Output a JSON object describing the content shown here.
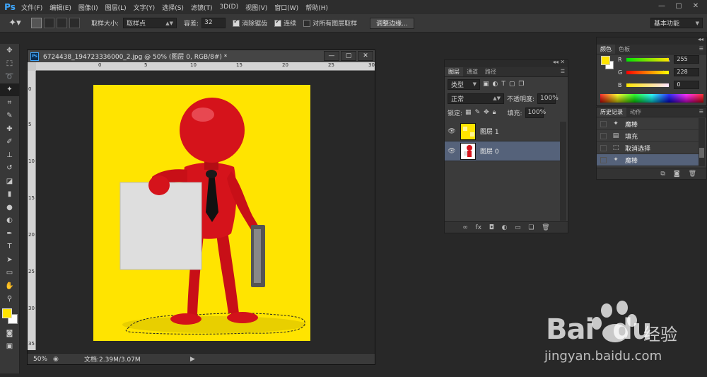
{
  "app": {
    "logo": "Ps",
    "menus": [
      "文件(F)",
      "编辑(E)",
      "图像(I)",
      "图层(L)",
      "文字(Y)",
      "选择(S)",
      "滤镜(T)",
      "3D(D)",
      "视图(V)",
      "窗口(W)",
      "帮助(H)"
    ],
    "window_controls": [
      "—",
      "▢",
      "✕"
    ]
  },
  "options": {
    "sample_size_label": "取样大小:",
    "sample_size_value": "取样点",
    "tolerance_label": "容差:",
    "tolerance_value": "32",
    "antialias_label": "消除锯齿",
    "contiguous_label": "连续",
    "all_layers_label": "对所有图层取样",
    "refine_edge_button": "调整边缘...",
    "workspace": "基本功能"
  },
  "document": {
    "title": "6724438_194723336000_2.jpg @ 50% (图层 0, RGB/8#) *",
    "ruler_h": [
      "0",
      "5",
      "10",
      "15",
      "20",
      "25",
      "30"
    ],
    "ruler_v": [
      "0",
      "5",
      "10",
      "15",
      "20",
      "25",
      "30",
      "35"
    ],
    "zoom": "50%",
    "doc_info": "文档:2.39M/3.07M",
    "colors": {
      "canvas": "#ffe400",
      "figure": "#d0101a"
    }
  },
  "layers_panel": {
    "tabs": [
      "图层",
      "通道",
      "路径"
    ],
    "filter_kind": "类型",
    "blend_mode": "正常",
    "opacity_label": "不透明度:",
    "opacity_value": "100%",
    "lock_label": "锁定:",
    "fill_label": "填充:",
    "fill_value": "100%",
    "layers": [
      {
        "name": "图层 1",
        "selected": false
      },
      {
        "name": "图层 0",
        "selected": true
      }
    ]
  },
  "color_panel": {
    "tabs": [
      "颜色",
      "色板"
    ],
    "channels": [
      {
        "name": "R",
        "value": "255"
      },
      {
        "name": "G",
        "value": "228"
      },
      {
        "name": "B",
        "value": "0"
      }
    ],
    "foreground": "#ffe400"
  },
  "history_panel": {
    "tabs": [
      "历史记录",
      "动作"
    ],
    "items": [
      {
        "name": "魔棒",
        "selected": false
      },
      {
        "name": "填充",
        "selected": false
      },
      {
        "name": "取消选择",
        "selected": false
      },
      {
        "name": "魔棒",
        "selected": true
      }
    ]
  },
  "watermark": {
    "brand": "Bai",
    "brand_suffix": "du",
    "cn": "经验",
    "url": "jingyan.baidu.com"
  }
}
